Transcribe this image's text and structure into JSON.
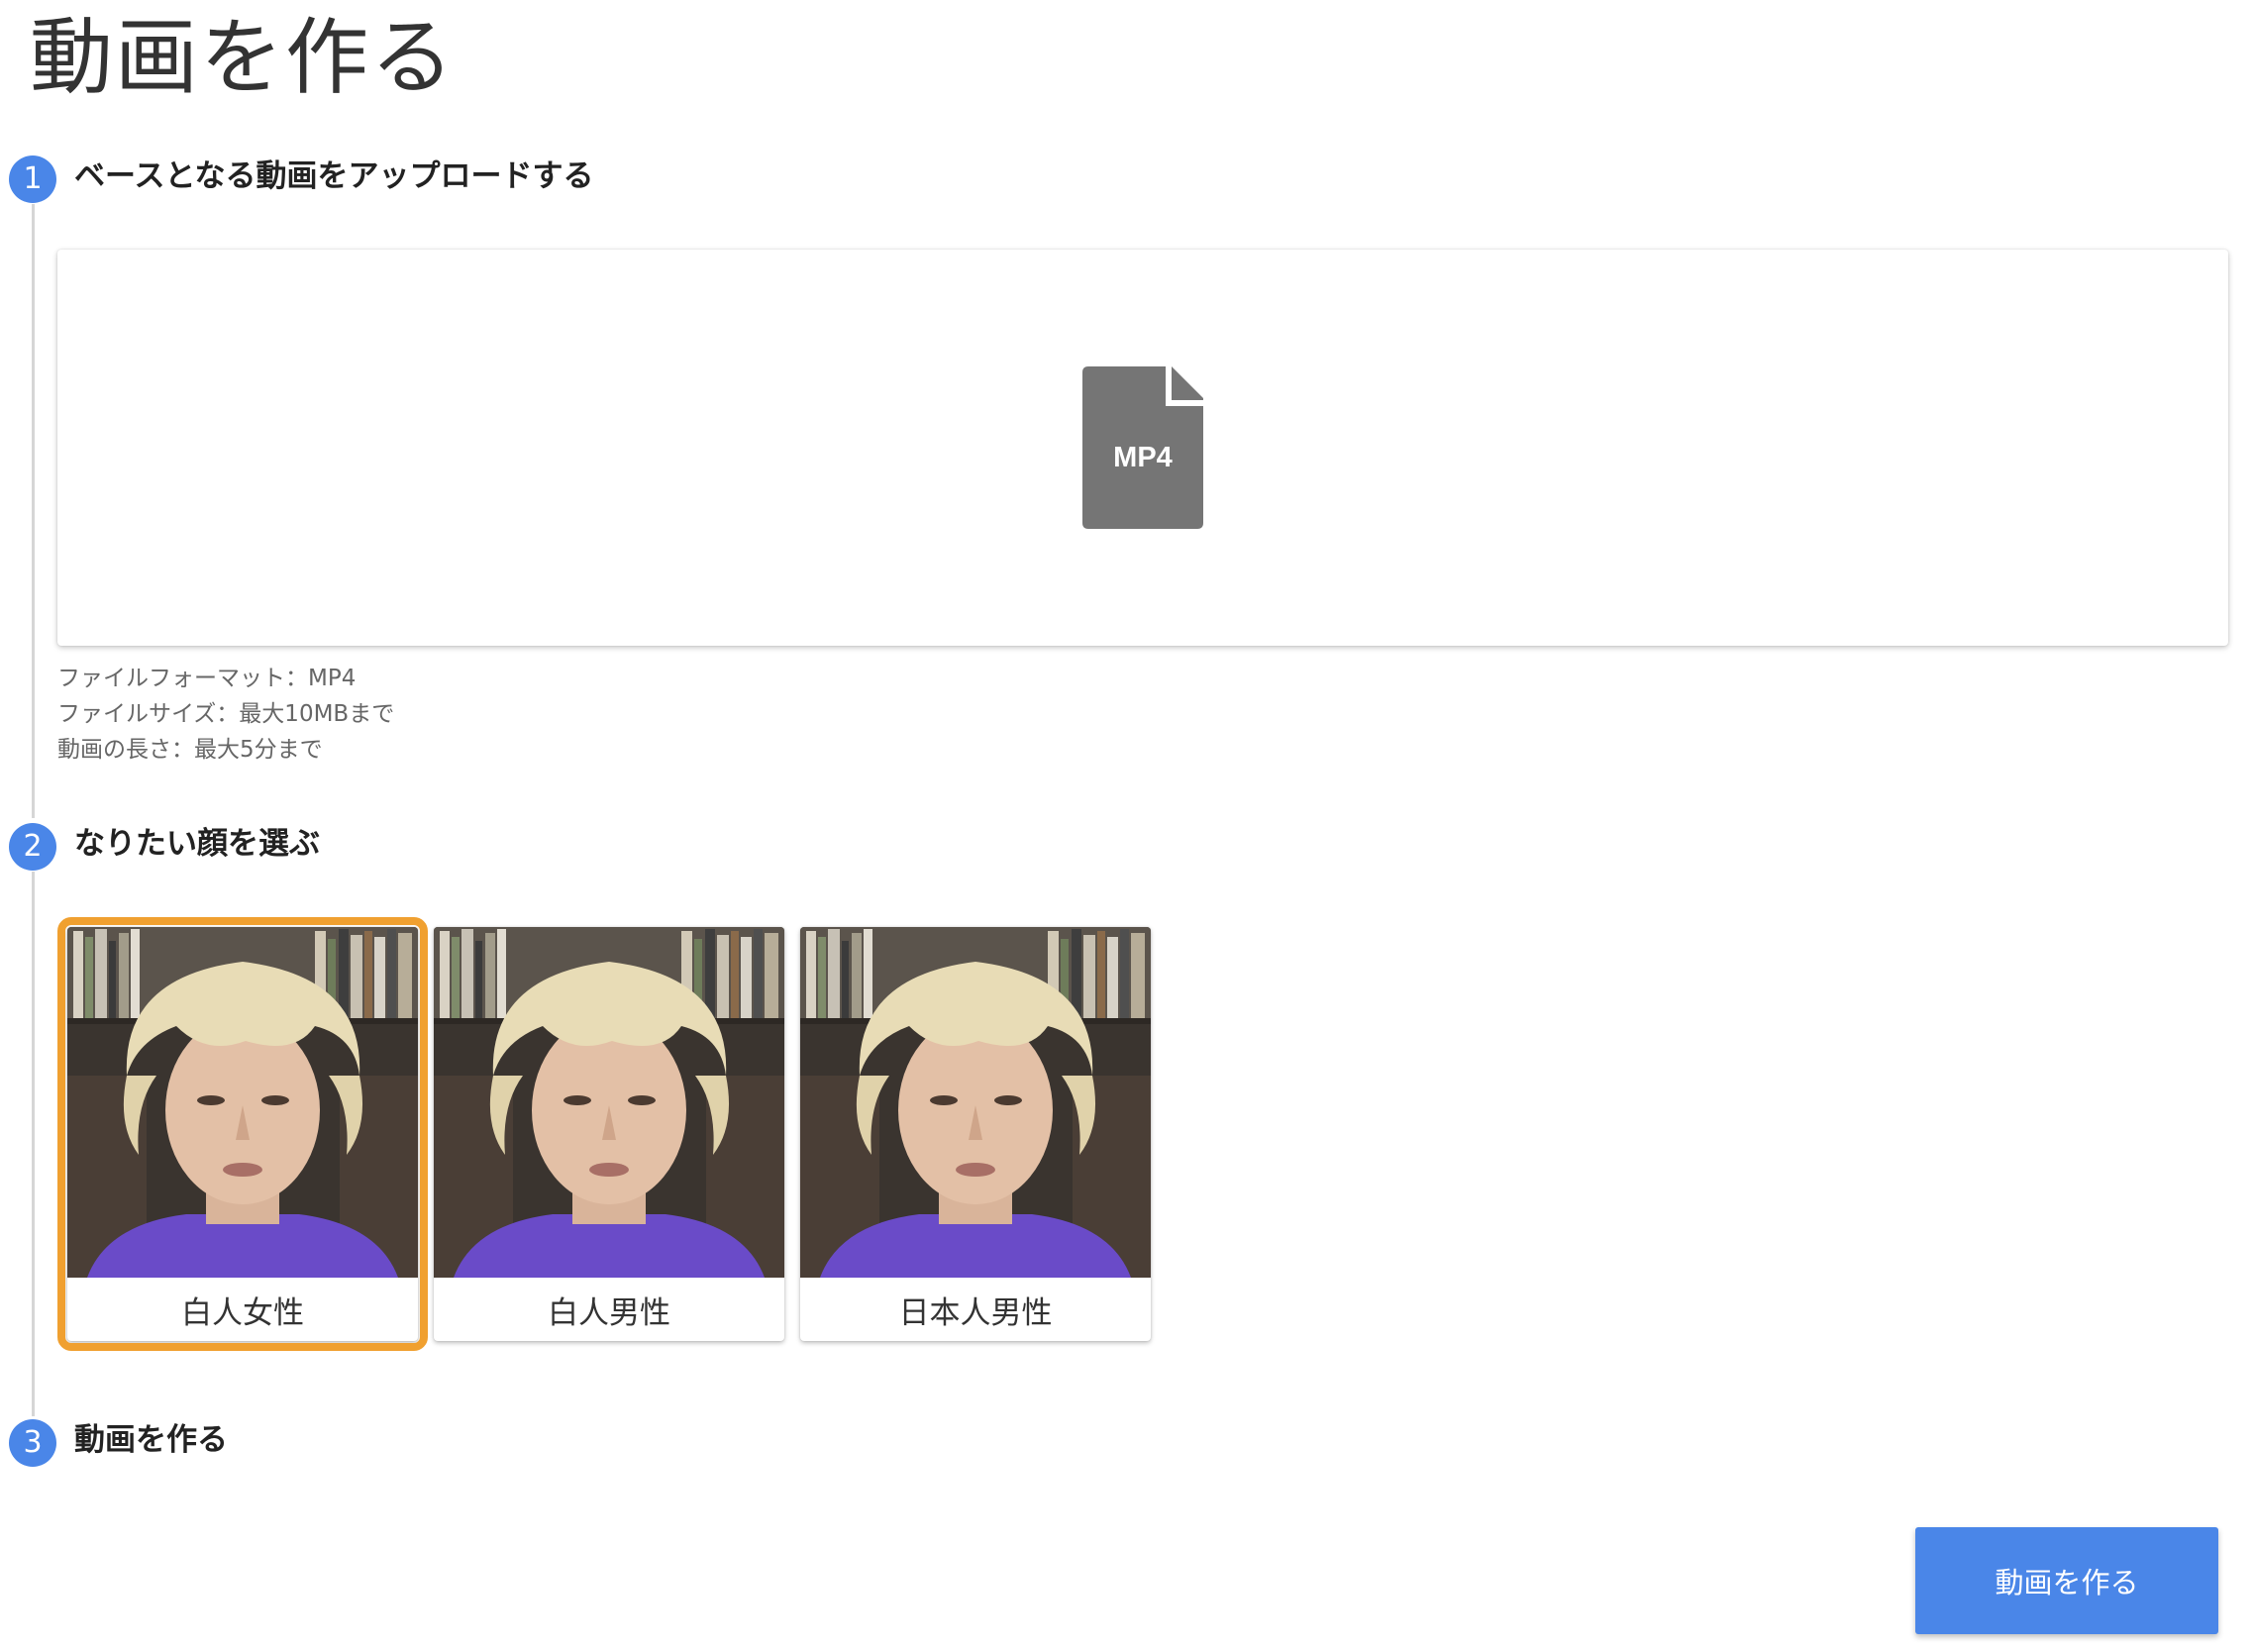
{
  "page": {
    "title": "動画を作る"
  },
  "steps": [
    {
      "number": "1",
      "label": "ベースとなる動画をアップロードする"
    },
    {
      "number": "2",
      "label": "なりたい顔を選ぶ"
    },
    {
      "number": "3",
      "label": "動画を作る"
    }
  ],
  "upload": {
    "icon": "mp4-file-icon",
    "icon_text": "MP4",
    "info": [
      "ファイルフォーマット：MP4",
      "ファイルサイズ：最大10MBまで",
      "動画の長さ：最大5分まで"
    ]
  },
  "faces": [
    {
      "label": "白人女性",
      "selected": true
    },
    {
      "label": "白人男性",
      "selected": false
    },
    {
      "label": "日本人男性",
      "selected": false
    }
  ],
  "create_button": {
    "label": "動画を作る"
  },
  "colors": {
    "accent": "#4a86e8",
    "selected_border": "#f0a030",
    "file_icon": "#757575"
  }
}
